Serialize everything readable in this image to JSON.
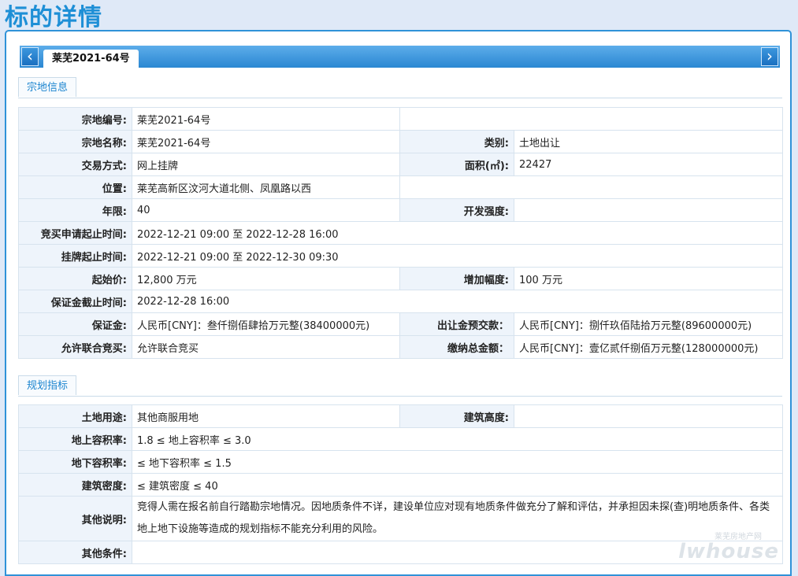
{
  "page_title": "标的详情",
  "tab": {
    "label": "莱芜2021-64号",
    "prev_icon": "chevron-left-icon",
    "next_icon": "chevron-right-icon"
  },
  "section1": {
    "title": "宗地信息",
    "rows": {
      "parcel_no_label": "宗地编号:",
      "parcel_no": "莱芜2021-64号",
      "parcel_name_label": "宗地名称:",
      "parcel_name": "莱芜2021-64号",
      "category_label": "类别:",
      "category": "土地出让",
      "trade_method_label": "交易方式:",
      "trade_method": "网上挂牌",
      "area_label": "面积(㎡):",
      "area": "22427",
      "location_label": "位置:",
      "location": "莱芜高新区汶河大道北侧、凤凰路以西",
      "term_label": "年限:",
      "term": "40",
      "intensity_label": "开发强度:",
      "intensity": "",
      "apply_period_label": "竞买申请起止时间:",
      "apply_period": "2022-12-21 09:00 至 2022-12-28 16:00",
      "listing_period_label": "挂牌起止时间:",
      "listing_period": "2022-12-21 09:00 至 2022-12-30 09:30",
      "start_price_label": "起始价:",
      "start_price": "12,800 万元",
      "increment_label": "增加幅度:",
      "increment": "100 万元",
      "deposit_deadline_label": "保证金截止时间:",
      "deposit_deadline": "2022-12-28 16:00",
      "deposit_label": "保证金:",
      "deposit": "人民币[CNY]：叁仟捌佰肆拾万元整(38400000元)",
      "prepay_label": "出让金预交款：",
      "prepay": "人民币[CNY]：捌仟玖佰陆拾万元整(89600000元)",
      "joint_bid_label": "允许联合竞买:",
      "joint_bid": "允许联合竞买",
      "total_label": "缴纳总金额：",
      "total": "人民币[CNY]：壹亿贰仟捌佰万元整(128000000元)"
    }
  },
  "section2": {
    "title": "规划指标",
    "rows": {
      "land_use_label": "土地用途:",
      "land_use": "其他商服用地",
      "height_label": "建筑高度:",
      "height": "",
      "far_above_label": "地上容积率:",
      "far_above": "1.8 ≤ 地上容积率 ≤ 3.0",
      "far_below_label": "地下容积率:",
      "far_below": "≤ 地下容积率 ≤ 1.5",
      "density_label": "建筑密度:",
      "density": "≤ 建筑密度 ≤ 40",
      "notes_label": "其他说明:",
      "notes": "竞得人需在报名前自行踏勘宗地情况。因地质条件不详，建设单位应对现有地质条件做充分了解和评估，并承担因未探(查)明地质条件、各类地上地下设施等造成的规划指标不能充分利用的风险。",
      "other_label": "其他条件:",
      "other": ""
    }
  },
  "watermark": {
    "cn": "莱芜房地产网",
    "en": "lwhouse"
  }
}
